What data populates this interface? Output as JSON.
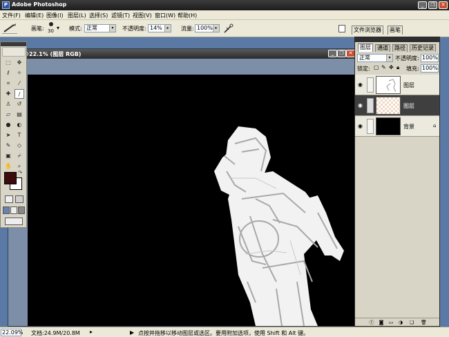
{
  "app": {
    "title": "Adobe Photoshop"
  },
  "menu": [
    "文件(F)",
    "编辑(E)",
    "图像(I)",
    "图层(L)",
    "选择(S)",
    "滤镜(T)",
    "视图(V)",
    "窗口(W)",
    "帮助(H)"
  ],
  "options": {
    "brush_label": "画笔:",
    "brush_size": "30",
    "mode_label": "模式:",
    "mode_value": "正常",
    "opacity_label": "不透明度:",
    "opacity_value": "14%",
    "flow_label": "流量:",
    "flow_value": "100%",
    "well_tabs": [
      "文件浏览器",
      "画笔"
    ]
  },
  "document": {
    "title": "22.1% (图层    RGB)"
  },
  "layers_panel": {
    "tabs": [
      "图层",
      "通道",
      "路径",
      "历史记录"
    ],
    "blend_mode": "正常",
    "opacity_label": "不透明度:",
    "opacity_value": "100%",
    "lock_label": "锁定:",
    "fill_label": "填充:",
    "fill_value": "100%",
    "layers": [
      {
        "name": "图层",
        "thumb": "sketch"
      },
      {
        "name": "图层",
        "thumb": "transparent"
      },
      {
        "name": "背景",
        "thumb": "black"
      }
    ]
  },
  "status": {
    "zoom": "22.09%",
    "doc_size": "文档:24.9M/20.8M",
    "hint": "点按并拖移以移动图层或选区。要用附加选项，使用 Shift 和 Alt 键。"
  },
  "colors": {
    "foreground": "#3b0c0b",
    "background": "#ffffff",
    "workspace": "#5a79a5"
  }
}
